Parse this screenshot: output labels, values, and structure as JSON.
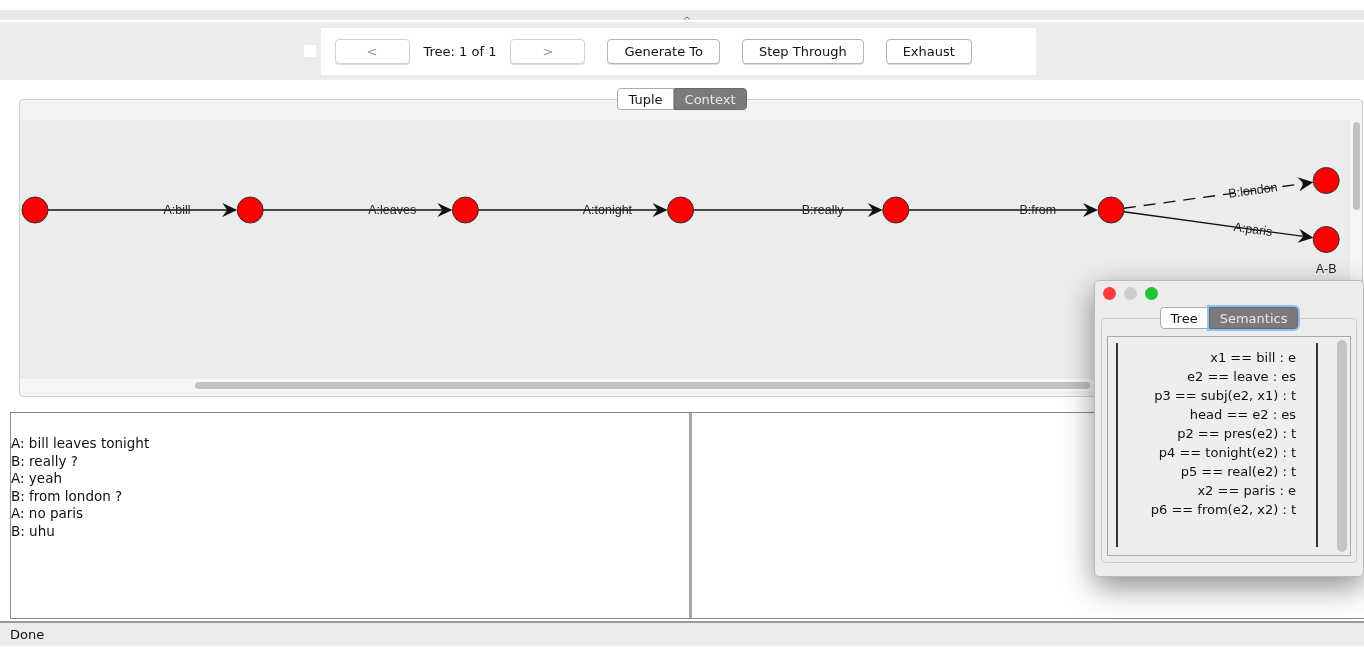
{
  "toolbar": {
    "checkbox": {
      "checked": false
    },
    "prev_button": {
      "label": "<",
      "disabled": true
    },
    "tree_counter": "Tree: 1 of 1",
    "next_button": {
      "label": ">",
      "disabled": true
    },
    "buttons": [
      "Generate To",
      "Step Through",
      "Exhaust"
    ]
  },
  "graph_tabs": [
    {
      "label": "Tuple",
      "selected": false
    },
    {
      "label": "Context",
      "selected": true
    }
  ],
  "graph": {
    "chain": [
      {
        "label": "A:bill",
        "dashed": false
      },
      {
        "label": "A:leaves",
        "dashed": false
      },
      {
        "label": "A:tonight",
        "dashed": false
      },
      {
        "label": "B:really",
        "dashed": false
      },
      {
        "label": "B:from",
        "dashed": false
      }
    ],
    "branches": [
      {
        "label": "B:london",
        "dashed": true
      },
      {
        "label": "A:paris",
        "dashed": false,
        "node_label": "A-B"
      }
    ]
  },
  "dialogue": [
    "A: bill leaves tonight",
    "B: really ?",
    "A: yeah",
    "B: from london ?",
    "A: no paris",
    "B: uhu"
  ],
  "status_bar": "Done",
  "semantics_window": {
    "tabs": [
      {
        "label": "Tree",
        "selected": false
      },
      {
        "label": "Semantics",
        "selected": true
      }
    ],
    "lines": [
      "x1 == bill : e",
      "e2 == leave : es",
      "p3 == subj(e2, x1) : t",
      "head == e2 : es",
      "p2 == pres(e2) : t",
      "p4 == tonight(e2) : t",
      "p5 == real(e2) : t",
      "x2 == paris : e",
      "p6 == from(e2, x2) : t"
    ]
  }
}
